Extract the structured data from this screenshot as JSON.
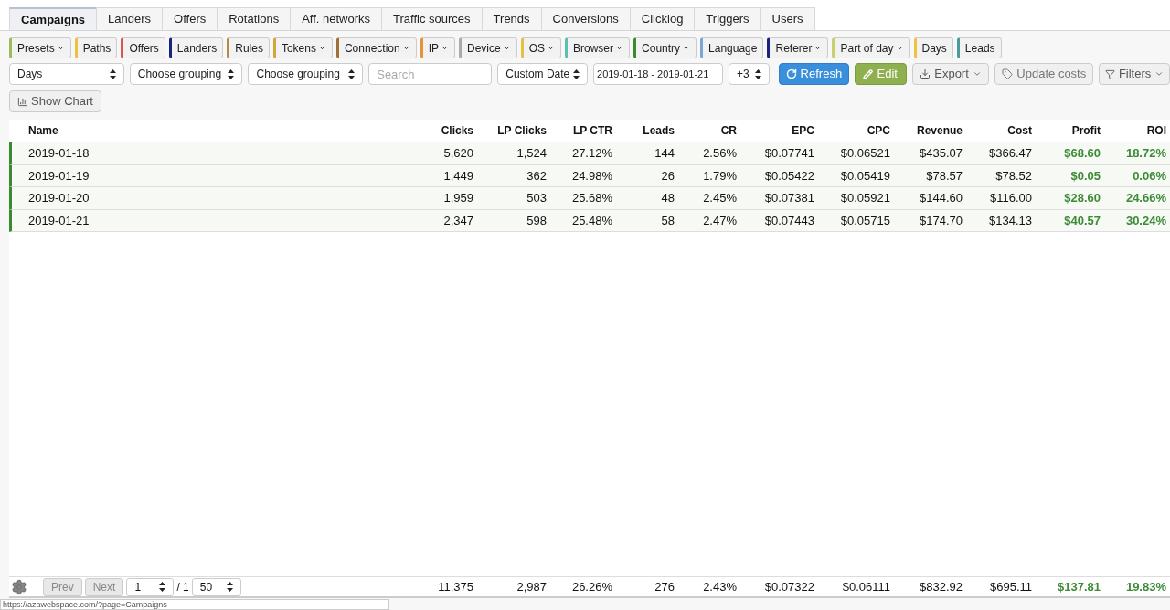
{
  "tabs": [
    {
      "label": "Campaigns",
      "selected": true
    },
    {
      "label": "Landers",
      "selected": false
    },
    {
      "label": "Offers",
      "selected": false
    },
    {
      "label": "Rotations",
      "selected": false
    },
    {
      "label": "Aff. networks",
      "selected": false
    },
    {
      "label": "Traffic sources",
      "selected": false
    },
    {
      "label": "Trends",
      "selected": false
    },
    {
      "label": "Conversions",
      "selected": false
    },
    {
      "label": "Clicklog",
      "selected": false
    },
    {
      "label": "Triggers",
      "selected": false
    },
    {
      "label": "Users",
      "selected": false
    }
  ],
  "filter_chips": [
    {
      "label": "Presets",
      "color": "#9cba5f",
      "dropdown": true
    },
    {
      "label": "Paths",
      "color": "#f0c040",
      "dropdown": false
    },
    {
      "label": "Offers",
      "color": "#d9534f",
      "dropdown": false
    },
    {
      "label": "Landers",
      "color": "#1a237e",
      "dropdown": false
    },
    {
      "label": "Rules",
      "color": "#b5894a",
      "dropdown": false
    },
    {
      "label": "Tokens",
      "color": "#d4a838",
      "dropdown": true
    },
    {
      "label": "Connection",
      "color": "#a0703c",
      "dropdown": true
    },
    {
      "label": "IP",
      "color": "#e8923a",
      "dropdown": true
    },
    {
      "label": "Device",
      "color": "#aaaaaa",
      "dropdown": true
    },
    {
      "label": "OS",
      "color": "#e6c040",
      "dropdown": true
    },
    {
      "label": "Browser",
      "color": "#5bc0b0",
      "dropdown": true
    },
    {
      "label": "Country",
      "color": "#3a8a30",
      "dropdown": true
    },
    {
      "label": "Language",
      "color": "#7ba6dc",
      "dropdown": false
    },
    {
      "label": "Referer",
      "color": "#1a237e",
      "dropdown": true
    },
    {
      "label": "Part of day",
      "color": "#c8d070",
      "dropdown": true
    },
    {
      "label": "Days",
      "color": "#f0c040",
      "dropdown": false
    },
    {
      "label": "Leads",
      "color": "#4a9a9a",
      "dropdown": false
    }
  ],
  "controls": [
    {
      "kind": "select",
      "value": "Days"
    },
    {
      "kind": "select",
      "value": "Choose grouping"
    },
    {
      "kind": "select",
      "value": "Choose grouping"
    },
    {
      "kind": "search",
      "placeholder": "Search"
    },
    {
      "kind": "select",
      "value": "Custom Date"
    },
    {
      "kind": "date",
      "value": "2019-01-18 - 2019-01-21"
    },
    {
      "kind": "select",
      "value": "+3"
    },
    {
      "kind": "refresh",
      "label": "Refresh"
    },
    {
      "kind": "edit",
      "label": "Edit"
    },
    {
      "kind": "export",
      "label": "Export"
    },
    {
      "kind": "update",
      "label": "Update costs"
    },
    {
      "kind": "filters",
      "label": "Filters"
    }
  ],
  "show_chart": "Show Chart",
  "table": {
    "columns": [
      "Name",
      "Clicks",
      "LP Clicks",
      "LP CTR",
      "Leads",
      "CR",
      "EPC",
      "CPC",
      "Revenue",
      "Cost",
      "Profit",
      "ROI"
    ],
    "rows": [
      [
        "2019-01-18",
        "5,620",
        "1,524",
        "27.12%",
        "144",
        "2.56%",
        "$0.07741",
        "$0.06521",
        "$435.07",
        "$366.47",
        "$68.60",
        "18.72%"
      ],
      [
        "2019-01-19",
        "1,449",
        "362",
        "24.98%",
        "26",
        "1.79%",
        "$0.05422",
        "$0.05419",
        "$78.57",
        "$78.52",
        "$0.05",
        "0.06%"
      ],
      [
        "2019-01-20",
        "1,959",
        "503",
        "25.68%",
        "48",
        "2.45%",
        "$0.07381",
        "$0.05921",
        "$144.60",
        "$116.00",
        "$28.60",
        "24.66%"
      ],
      [
        "2019-01-21",
        "2,347",
        "598",
        "25.48%",
        "58",
        "2.47%",
        "$0.07443",
        "$0.05715",
        "$174.70",
        "$134.13",
        "$40.57",
        "30.24%"
      ]
    ],
    "totals": [
      "11,375",
      "2,987",
      "26.26%",
      "276",
      "2.43%",
      "$0.07322",
      "$0.06111",
      "$832.92",
      "$695.11",
      "$137.81",
      "19.83%"
    ]
  },
  "pager": {
    "prev": "Prev",
    "next": "Next",
    "page": "1",
    "of": "/ 1",
    "per_page": "50"
  },
  "status_link": "https://azawebspace.com/?page=Campaigns"
}
